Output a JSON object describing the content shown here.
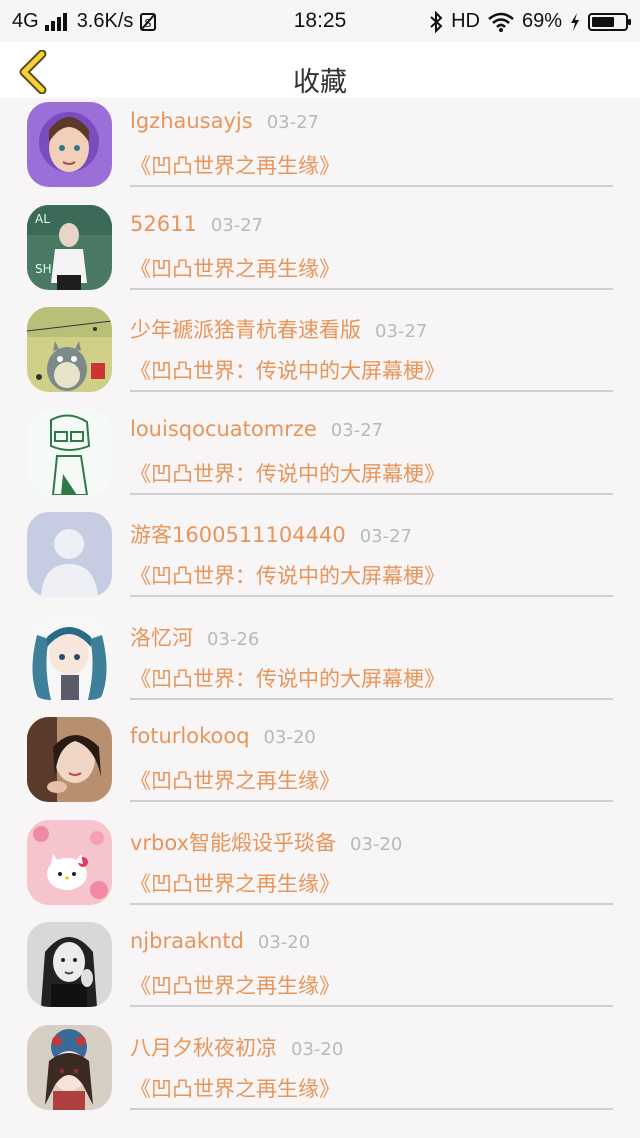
{
  "status_bar": {
    "network": "4G",
    "speed": "3.6K/s",
    "time": "18:25",
    "hd": "HD",
    "battery_text": "69%",
    "battery_level": 0.69
  },
  "nav": {
    "title": "收藏"
  },
  "items": [
    {
      "username": "lgzhausayjs",
      "date": "03-27",
      "title": "《凹凸世界之再生缘》",
      "avatar": "avatar-anime-girl-purple-hood"
    },
    {
      "username": "52611",
      "date": "03-27",
      "title": "《凹凸世界之再生缘》",
      "avatar": "avatar-girl-green-wall"
    },
    {
      "username": "少年褫派猞青杭春速看版",
      "date": "03-27",
      "title": "《凹凸世界：传说中的大屏幕梗》",
      "avatar": "avatar-totoro"
    },
    {
      "username": "louisqocuatomrze",
      "date": "03-27",
      "title": "《凹凸世界：传说中的大屏幕梗》",
      "avatar": "avatar-green-sketch-boy"
    },
    {
      "username": "游客1600511104440",
      "date": "03-27",
      "title": "《凹凸世界：传说中的大屏幕梗》",
      "avatar": "avatar-default-placeholder"
    },
    {
      "username": "洛忆河",
      "date": "03-26",
      "title": "《凹凸世界：传说中的大屏幕梗》",
      "avatar": "avatar-miku"
    },
    {
      "username": "foturlokooq",
      "date": "03-20",
      "title": "《凹凸世界之再生缘》",
      "avatar": "avatar-girl-photo"
    },
    {
      "username": "vrbox智能煅设乎琰备",
      "date": "03-20",
      "title": "《凹凸世界之再生缘》",
      "avatar": "avatar-hello-kitty"
    },
    {
      "username": "njbraakntd",
      "date": "03-20",
      "title": "《凹凸世界之再生缘》",
      "avatar": "avatar-bw-girl"
    },
    {
      "username": "八月夕秋夜初凉",
      "date": "03-20",
      "title": "《凹凸世界之再生缘》",
      "avatar": "avatar-anime-girl-ornate"
    }
  ]
}
